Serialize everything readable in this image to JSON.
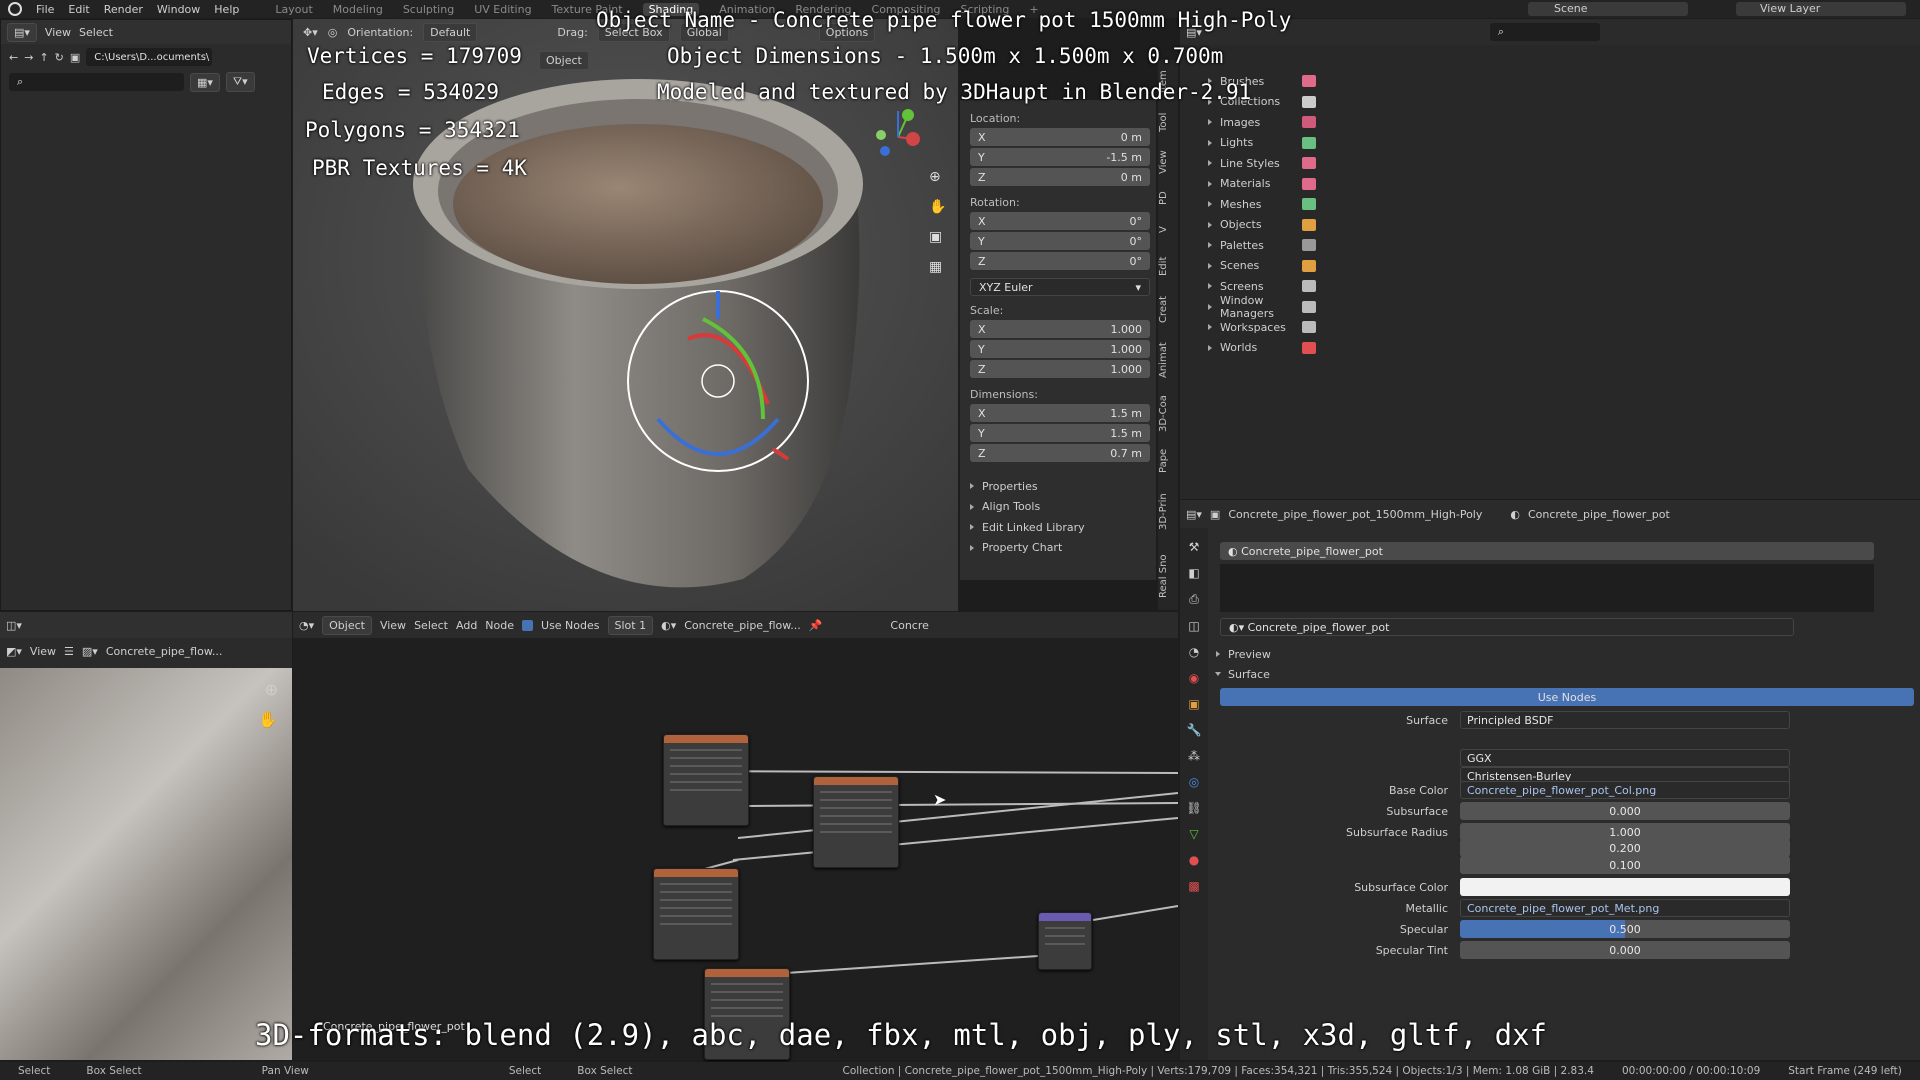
{
  "topbar": {
    "menu": [
      "File",
      "Edit",
      "Render",
      "Window",
      "Help"
    ],
    "tabs": [
      "Layout",
      "Modeling",
      "Sculpting",
      "UV Editing",
      "Texture Paint",
      "Shading",
      "Animation",
      "Rendering",
      "Compositing",
      "Scripting"
    ],
    "active_tab": "Shading",
    "scene": "Scene",
    "view_layer": "View Layer"
  },
  "overlay": {
    "object_name": "Object Name - Concrete pipe flower pot 1500mm High-Poly",
    "dimensions": "Object Dimensions - 1.500m x 1.500m x 0.700m",
    "credit": "Modeled and textured by 3DHaupt in Blender-2.91",
    "vertices": "Vertices = 179709",
    "edges": "Edges = 534029",
    "polygons": "Polygons = 354321",
    "textures": "PBR Textures = 4K",
    "formats": "3D-formats: blend (2.9), abc, dae, fbx, mtl, obj, ply, stl, x3d, gltf, dxf"
  },
  "filebrowser": {
    "view": "View",
    "select": "Select",
    "path": "C:\\Users\\D...ocuments\\"
  },
  "viewport": {
    "orientation_label": "Orientation:",
    "orientation_value": "Default",
    "drag_label": "Drag:",
    "drag_value": "Select Box",
    "transform_value": "Global",
    "options": "Options",
    "object_menu": "Object"
  },
  "npanel": {
    "location_label": "Location:",
    "location": [
      {
        "axis": "X",
        "val": "0 m"
      },
      {
        "axis": "Y",
        "val": "-1.5 m"
      },
      {
        "axis": "Z",
        "val": "0 m"
      }
    ],
    "rotation_label": "Rotation:",
    "rotation": [
      {
        "axis": "X",
        "val": "0°"
      },
      {
        "axis": "Y",
        "val": "0°"
      },
      {
        "axis": "Z",
        "val": "0°"
      }
    ],
    "rotation_mode": "XYZ Euler",
    "scale_label": "Scale:",
    "scale": [
      {
        "axis": "X",
        "val": "1.000"
      },
      {
        "axis": "Y",
        "val": "1.000"
      },
      {
        "axis": "Z",
        "val": "1.000"
      }
    ],
    "dimensions_label": "Dimensions:",
    "dimensions": [
      {
        "axis": "X",
        "val": "1.5 m"
      },
      {
        "axis": "Y",
        "val": "1.5 m"
      },
      {
        "axis": "Z",
        "val": "0.7 m"
      }
    ],
    "sections": [
      "Properties",
      "Align Tools",
      "Edit Linked Library",
      "Property Chart"
    ],
    "vtabs": [
      "Item",
      "Tool",
      "View",
      "PD",
      "V",
      "Edit",
      "Creat",
      "Animat",
      "3D-Coa",
      "Pape",
      "3D-Prin",
      "Real Sno"
    ]
  },
  "outliner": {
    "items": [
      {
        "label": "Brushes",
        "icon": "brush-icon",
        "color": "#e06a8a"
      },
      {
        "label": "Collections",
        "icon": "collection-icon",
        "color": "#cccccc"
      },
      {
        "label": "Images",
        "icon": "image-icon",
        "color": "#d05a7a"
      },
      {
        "label": "Lights",
        "icon": "light-icon",
        "color": "#6ac080"
      },
      {
        "label": "Line Styles",
        "icon": "linestyle-icon",
        "color": "#e06a8a"
      },
      {
        "label": "Materials",
        "icon": "material-icon",
        "color": "#e06a8a"
      },
      {
        "label": "Meshes",
        "icon": "mesh-icon",
        "color": "#6ac080"
      },
      {
        "label": "Objects",
        "icon": "object-icon",
        "color": "#e0a040"
      },
      {
        "label": "Palettes",
        "icon": "palette-icon",
        "color": "#999999"
      },
      {
        "label": "Scenes",
        "icon": "scene-icon",
        "color": "#e0a040"
      },
      {
        "label": "Screens",
        "icon": "screen-icon",
        "color": "#bbbbbb"
      },
      {
        "label": "Window Managers",
        "icon": "wm-icon",
        "color": "#bbbbbb"
      },
      {
        "label": "Workspaces",
        "icon": "workspace-icon",
        "color": "#bbbbbb"
      },
      {
        "label": "Worlds",
        "icon": "world-icon",
        "color": "#e05050"
      }
    ]
  },
  "shader": {
    "object_mode": "Object",
    "menus": [
      "View",
      "Select",
      "Add",
      "Node"
    ],
    "use_nodes": "Use Nodes",
    "slot": "Slot 1",
    "material": "Concrete_pipe_flow...",
    "material_short": "Concre",
    "node_label": "Concrete_pipe_flower_pot"
  },
  "imageeditor": {
    "view": "View",
    "image": "Concrete_pipe_flow..."
  },
  "properties": {
    "breadcrumb_object": "Concrete_pipe_flower_pot_1500mm_High-Poly",
    "breadcrumb_material": "Concrete_pipe_flower_pot",
    "slot_item": "Concrete_pipe_flower_pot",
    "material_name": "Concrete_pipe_flower_pot",
    "preview": "Preview",
    "surface_section": "Surface",
    "use_nodes": "Use Nodes",
    "rows": [
      {
        "label": "Surface",
        "value": "Principled BSDF",
        "style": "plain"
      },
      {
        "label": "",
        "value": "GGX",
        "style": "plain"
      },
      {
        "label": "",
        "value": "Christensen-Burley",
        "style": "plain"
      },
      {
        "label": "Base Color",
        "value": "Concrete_pipe_flower_pot_Col.png",
        "style": "plain"
      },
      {
        "label": "Subsurface",
        "value": "0.000",
        "style": "center"
      },
      {
        "label": "Subsurface Radius",
        "value": "1.000",
        "style": "center"
      },
      {
        "label": "",
        "value": "0.200",
        "style": "center"
      },
      {
        "label": "",
        "value": "0.100",
        "style": "center"
      },
      {
        "label": "Subsurface Color",
        "value": "",
        "style": "white"
      },
      {
        "label": "Metallic",
        "value": "Concrete_pipe_flower_pot_Met.png",
        "style": "plain"
      },
      {
        "label": "Specular",
        "value": "0.500",
        "style": "blue"
      },
      {
        "label": "Specular Tint",
        "value": "0.000",
        "style": "center"
      }
    ]
  },
  "statusbar": {
    "left": [
      "Select",
      "Box Select",
      "Pan View",
      "Select",
      "Box Select"
    ],
    "info": "Collection | Concrete_pipe_flower_pot_1500mm_High-Poly | Verts:179,709 | Faces:354,321 | Tris:355,524 | Objects:1/3 | Mem: 1.08 GiB | 2.83.4",
    "timecode": "00:00:00:00 / 00:00:10:09",
    "frame": "Start Frame (249 left)"
  }
}
